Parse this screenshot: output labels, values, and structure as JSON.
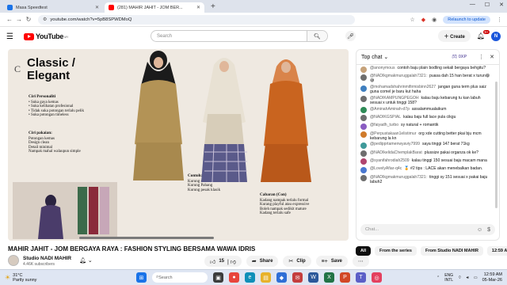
{
  "browser": {
    "tabs": [
      {
        "title": "Masa Speedtest",
        "color": "#1a73e8",
        "active": false
      },
      {
        "title": "(281) MAHIR JAHIT - JOM BER...",
        "color": "#ff0000",
        "active": true
      }
    ],
    "url": "youtube.com/watch?v=5pB8SPWDMoQ",
    "relaunch_label": "Relaunch to update"
  },
  "youtube": {
    "logo_text": "YouTube",
    "logo_sup": "MY",
    "search_placeholder": "Search",
    "create_label": "Create",
    "notif_count": "9+",
    "avatar_letter": "N"
  },
  "video": {
    "slide_letter": "C",
    "slide_title_1": "Classic /",
    "slide_title_2": "Elegant",
    "ciri_personaliti": {
      "heading": "Ciri Personaliti",
      "items": [
        "Suka gaya kemas",
        "Suka kelihatan profesional",
        "Tidak suka potongan terlalu pelik",
        "Suka potongan timeless"
      ]
    },
    "ciri_pakaian": {
      "heading": "Ciri pakaian:",
      "items": [
        "Potongan kemas",
        "Design clean",
        "Detail minimal",
        "Nampak mahal walaupun simple"
      ]
    },
    "contoh": {
      "heading": "Contoh:",
      "items": [
        "Kurung moden structured",
        "Kurung Pahang",
        "Kurung pesak klasik"
      ]
    },
    "cabaran": {
      "heading": "Cabaran (Con)",
      "items": [
        "Kadang nampak terlalu formal",
        "Kurang playful atau expressive",
        "Boleh nampak sedikit mature",
        "Kadang terlalu safe"
      ]
    },
    "progress": 0.35
  },
  "video_info": {
    "title": "MAHIR JAHIT - JOM BERGAYA RAYA : FASHION STYLING BERSAMA WAWA IDRIS",
    "channel_name": "Studio NADI MAHIR",
    "subscribers": "4.46K subscribers",
    "like_count": "15",
    "share_label": "Share",
    "clip_label": "Clip",
    "save_label": "Save"
  },
  "chat": {
    "header": "Top chat",
    "gxp_label": "0XP",
    "input_placeholder": "Chat...",
    "messages": [
      {
        "author": "@anonymous",
        "text": "contoh baju plain bodling sekali bergaya behgitu?",
        "color": "#c6a27a"
      },
      {
        "author": "@NADIkgmakmuruggalah7321:",
        "text": "puasa dah 15 han berat x turun😄 😅",
        "color": "#6e6e6e"
      },
      {
        "author": "@mohamadshahrinmifirmisbinn2627",
        "text": "jangan guna term plus saiz guna comel je baru kut haha",
        "color": "#3f7fbf"
      },
      {
        "author": "@NADIKAMPUNGPEGOH",
        "text": "kalau baju kebarung tu kan labuh sesuai x untuk tinggi 158?",
        "color": "#6e6e6e"
      },
      {
        "author": "@AminahAminah-d7p",
        "text": "assalammualaikum",
        "color": "#2e8b57"
      },
      {
        "author": "@NADIKGSPIAL",
        "text": "kalau baju full lace pula cikgu",
        "color": "#6e6e6e"
      },
      {
        "author": "@faiyadh_turbo",
        "text": "sy natural + romantik",
        "color": "#8a5cc2"
      },
      {
        "author": "@Perpustakaan1elistimur",
        "text": "org xde cutting better pkai bju mcm kebarung la kn",
        "color": "#d07b2b"
      },
      {
        "author": "@pedipprtamenwyaviy7999",
        "text": "saya tinggi 147 berat 71kg",
        "color": "#3f9a9a"
      },
      {
        "author": "@NADIkelidaChemplakBarat",
        "text": "plussize pakai organza ok ke?",
        "color": "#6e6e6e"
      },
      {
        "author": "@syanifahrodiah2509",
        "text": "kalau tinggi 150 sesuai baju macam mana",
        "color": "#b0456f"
      },
      {
        "author": "@LovelyAfiar-q4c",
        "text": "🏅 #2 tips : LACE akan menebalkan badan.",
        "color": "#4a78d0"
      },
      {
        "author": "@NADIkgmakmuruggalah7321:",
        "text": "tinggi sy 151 sesuai x pakai baju labuh2",
        "color": "#6e6e6e"
      }
    ]
  },
  "chips": [
    "All",
    "From the series",
    "From Studio NADI MAHIR",
    "12:59 AM"
  ],
  "taskbar": {
    "temperature": "31°C",
    "weather_desc": "Partly sunny",
    "search_placeholder": "Search",
    "lang_top": "ENG",
    "lang_bottom": "INTL",
    "time": "12:59 AM",
    "date": "05-Mar-26"
  }
}
